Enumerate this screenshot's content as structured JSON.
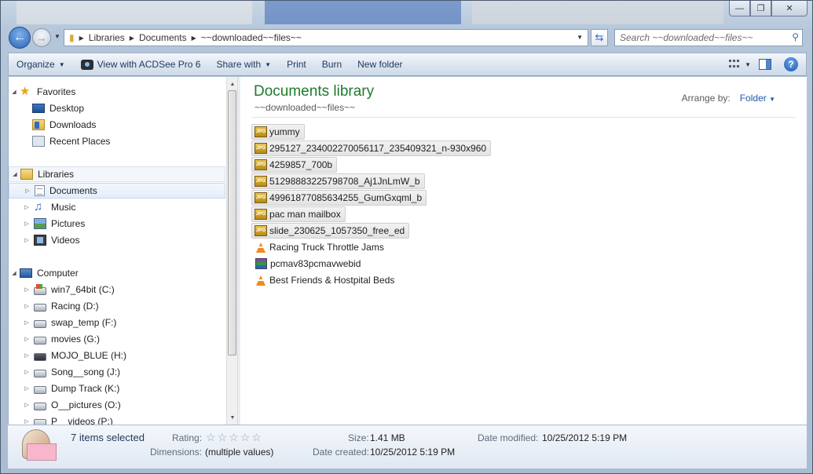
{
  "window": {
    "caption": {
      "minimize": "—",
      "maximize": "❐",
      "close": "✕"
    }
  },
  "nav": {
    "breadcrumb": [
      "Libraries",
      "Documents",
      "~~downloaded~~files~~"
    ],
    "search_placeholder": "Search ~~downloaded~~files~~"
  },
  "toolbar": {
    "organize": "Organize",
    "acdsee": "View with ACDSee Pro 6",
    "share": "Share with",
    "print": "Print",
    "burn": "Burn",
    "new_folder": "New folder"
  },
  "sidebar": {
    "favorites": {
      "label": "Favorites",
      "items": [
        "Desktop",
        "Downloads",
        "Recent Places"
      ]
    },
    "libraries": {
      "label": "Libraries",
      "items": [
        "Documents",
        "Music",
        "Pictures",
        "Videos"
      ]
    },
    "computer": {
      "label": "Computer",
      "items": [
        "win7_64bit (C:)",
        "Racing (D:)",
        "swap_temp (F:)",
        "movies (G:)",
        "MOJO_BLUE (H:)",
        "Song__song (J:)",
        "Dump Track (K:)",
        "O__pictures (O:)",
        "P__videos (P:)"
      ]
    }
  },
  "content": {
    "title": "Documents library",
    "subtitle": "~~downloaded~~files~~",
    "arrange_label": "Arrange by:",
    "arrange_value": "Folder",
    "files": [
      {
        "name": "yummy",
        "type": "jpg",
        "selected": true
      },
      {
        "name": "295127_234002270056117_235409321_n-930x960",
        "type": "jpg",
        "selected": true
      },
      {
        "name": "4259857_700b",
        "type": "jpg",
        "selected": true
      },
      {
        "name": "51298883225798708_Aj1JnLmW_b",
        "type": "jpg",
        "selected": true
      },
      {
        "name": "49961877085634255_GumGxqml_b",
        "type": "jpg",
        "selected": true
      },
      {
        "name": "pac man mailbox",
        "type": "jpg",
        "selected": true
      },
      {
        "name": "slide_230625_1057350_free_ed",
        "type": "jpg",
        "selected": true
      },
      {
        "name": "Racing Truck Throttle Jams",
        "type": "vlc",
        "selected": false
      },
      {
        "name": "pcmav83pcmavwebid",
        "type": "rar",
        "selected": false
      },
      {
        "name": "Best Friends & Hostpital Beds",
        "type": "vlc",
        "selected": false
      }
    ],
    "jpg_badge": "JPG"
  },
  "details": {
    "selected_text": "7 items selected",
    "rating_label": "Rating:",
    "rating_value": 0,
    "dimensions_label": "Dimensions:",
    "dimensions_value": "(multiple values)",
    "size_label": "Size:",
    "size_value": "1.41 MB",
    "date_created_label": "Date created:",
    "date_created_value": "10/25/2012 5:19 PM",
    "date_modified_label": "Date modified:",
    "date_modified_value": "10/25/2012 5:19 PM"
  }
}
